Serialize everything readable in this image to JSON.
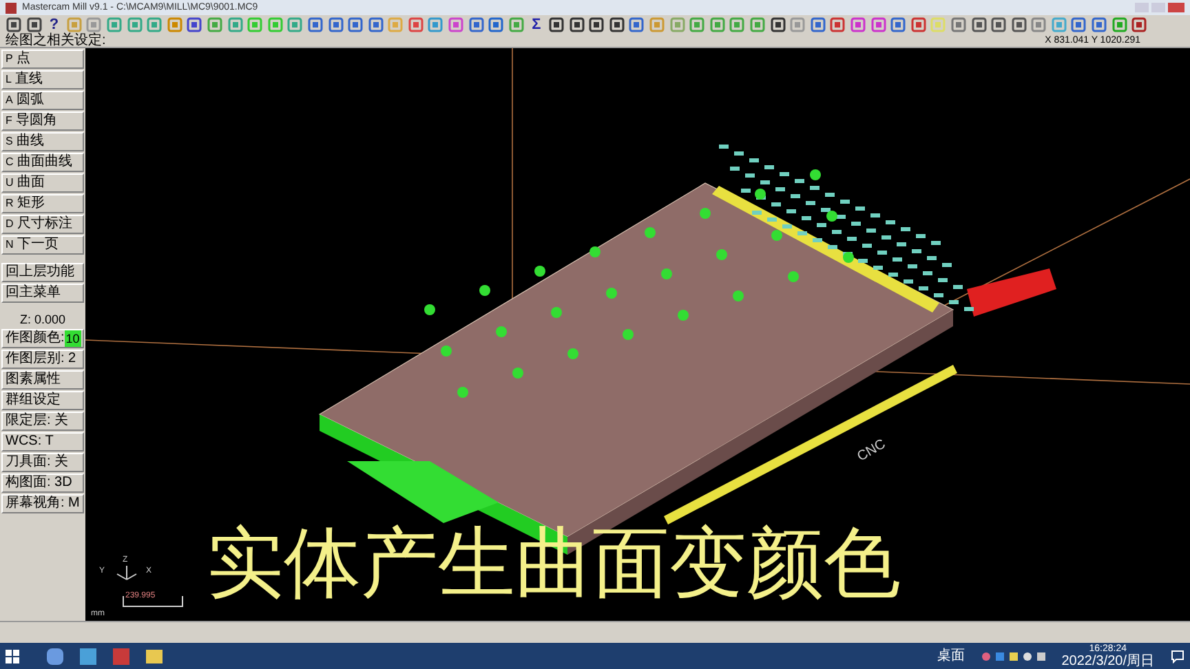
{
  "window": {
    "title": "Mastercam Mill v9.1 - C:\\MCAM9\\MILL\\MC9\\9001.MC9"
  },
  "toolbar_glyphs": {
    "help": "?",
    "sum": "Σ"
  },
  "prompt": "绘图之相关设定:",
  "coordinates": "X 831.041  Y 1020.291",
  "menu": [
    {
      "key": "P",
      "label": "点"
    },
    {
      "key": "L",
      "label": "直线"
    },
    {
      "key": "A",
      "label": "圆弧"
    },
    {
      "key": "F",
      "label": "导圆角"
    },
    {
      "key": "S",
      "label": "曲线"
    },
    {
      "key": "C",
      "label": "曲面曲线"
    },
    {
      "key": "U",
      "label": "曲面"
    },
    {
      "key": "R",
      "label": "矩形"
    },
    {
      "key": "D",
      "label": "尺寸标注"
    },
    {
      "key": "N",
      "label": "下一页"
    }
  ],
  "nav_buttons": [
    "回上层功能",
    "回主菜单"
  ],
  "settings": [
    {
      "kind": "text",
      "label": "Z:  0.000"
    },
    {
      "kind": "color",
      "label": "作图颜色:",
      "value": "10",
      "color": "#33dd33"
    },
    {
      "kind": "button",
      "label": "作图层别: 2"
    },
    {
      "kind": "button",
      "label": "图素属性"
    },
    {
      "kind": "button",
      "label": "群组设定"
    },
    {
      "kind": "button",
      "label": "限定层: 关"
    },
    {
      "kind": "button",
      "label": "WCS: T"
    },
    {
      "kind": "button",
      "label": "刀具面: 关"
    },
    {
      "kind": "button",
      "label": "构图面: 3D"
    },
    {
      "kind": "button",
      "label": "屏幕视角: M"
    }
  ],
  "viewport": {
    "axis_labels": [
      "Z",
      "Y",
      "X"
    ],
    "scale": "239.995",
    "units": "mm",
    "model_labels": [
      "CNC"
    ]
  },
  "subtitle": "实体产生曲面变颜色",
  "taskbar": {
    "tray_label": "桌面",
    "time": "16:28:24",
    "date": "2022/3/20/周日"
  }
}
